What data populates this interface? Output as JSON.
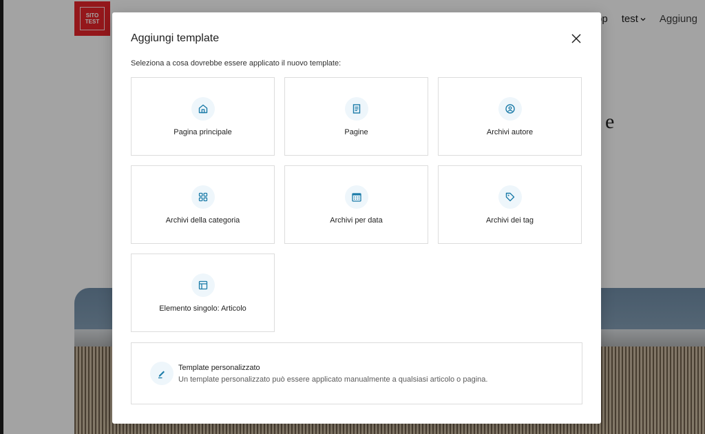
{
  "background": {
    "logo_line1": "SITO",
    "logo_line2": "TEST",
    "nav": {
      "item_partial": "op",
      "item_test": "test",
      "item_aggiungi": "Aggiung"
    },
    "hero_letter": "e"
  },
  "modal": {
    "title": "Aggiungi template",
    "description": "Seleziona a cosa dovrebbe essere applicato il nuovo template:",
    "cards": [
      {
        "label": "Pagina principale",
        "icon": "home-icon"
      },
      {
        "label": "Pagine",
        "icon": "page-icon"
      },
      {
        "label": "Archivi autore",
        "icon": "author-icon"
      },
      {
        "label": "Archivi della categoria",
        "icon": "category-icon"
      },
      {
        "label": "Archivi per data",
        "icon": "calendar-icon"
      },
      {
        "label": "Archivi dei tag",
        "icon": "tag-icon"
      },
      {
        "label": "Elemento singolo: Articolo",
        "icon": "layout-icon"
      }
    ],
    "custom": {
      "title": "Template personalizzato",
      "description": "Un template personalizzato può essere applicato manualmente a qualsiasi articolo o pagina.",
      "icon": "pencil-icon"
    }
  },
  "colors": {
    "accent": "#1b7ba8",
    "logo_red": "#e4242a",
    "icon_bg": "#eef6fb"
  }
}
